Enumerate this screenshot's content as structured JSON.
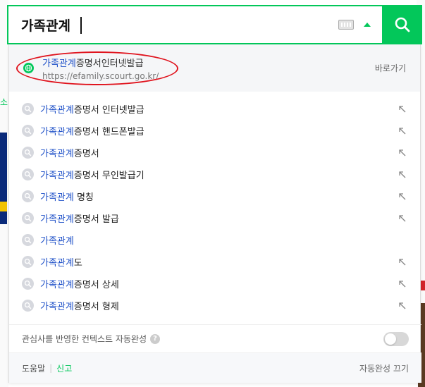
{
  "search": {
    "query": "가족관계"
  },
  "site_suggestion": {
    "title_highlight": "가족관계",
    "title_rest": "증명서인터넷발급",
    "url": "https://efamily.scourt.go.kr/",
    "goto_label": "바로가기"
  },
  "suggestions": [
    {
      "highlight": "가족관계",
      "rest": "증명서 인터넷발급",
      "fill": true
    },
    {
      "highlight": "가족관계",
      "rest": "증명서 핸드폰발급",
      "fill": true
    },
    {
      "highlight": "가족관계",
      "rest": "증명서",
      "fill": true
    },
    {
      "highlight": "가족관계",
      "rest": "증명서 무인발급기",
      "fill": true
    },
    {
      "highlight": "가족관계",
      "rest": " 명칭",
      "fill": true
    },
    {
      "highlight": "가족관계",
      "rest": "증명서 발급",
      "fill": true
    },
    {
      "highlight": "가족관계",
      "rest": "",
      "fill": false
    },
    {
      "highlight": "가족관계",
      "rest": "도",
      "fill": true
    },
    {
      "highlight": "가족관계",
      "rest": "증명서 상세",
      "fill": true
    },
    {
      "highlight": "가족관계",
      "rest": "증명서 형제",
      "fill": true
    }
  ],
  "context": {
    "label": "관심사를 반영한 컨텍스트 자동완성",
    "help_glyph": "?"
  },
  "footer": {
    "help": "도움말",
    "report": "신고",
    "autocomplete_off": "자동완성 끄기"
  },
  "background": {
    "left_text": "소"
  },
  "colors": {
    "accent": "#03c75a",
    "highlight": "#1e50c8",
    "annotation": "#e0141e"
  },
  "icons": {
    "search": "search-icon",
    "keyboard": "keyboard-icon",
    "collapse": "arrow-up-icon",
    "site": "globe-icon",
    "suggestion": "magnifier-icon",
    "fill": "arrow-up-left-icon",
    "help": "question-icon"
  }
}
